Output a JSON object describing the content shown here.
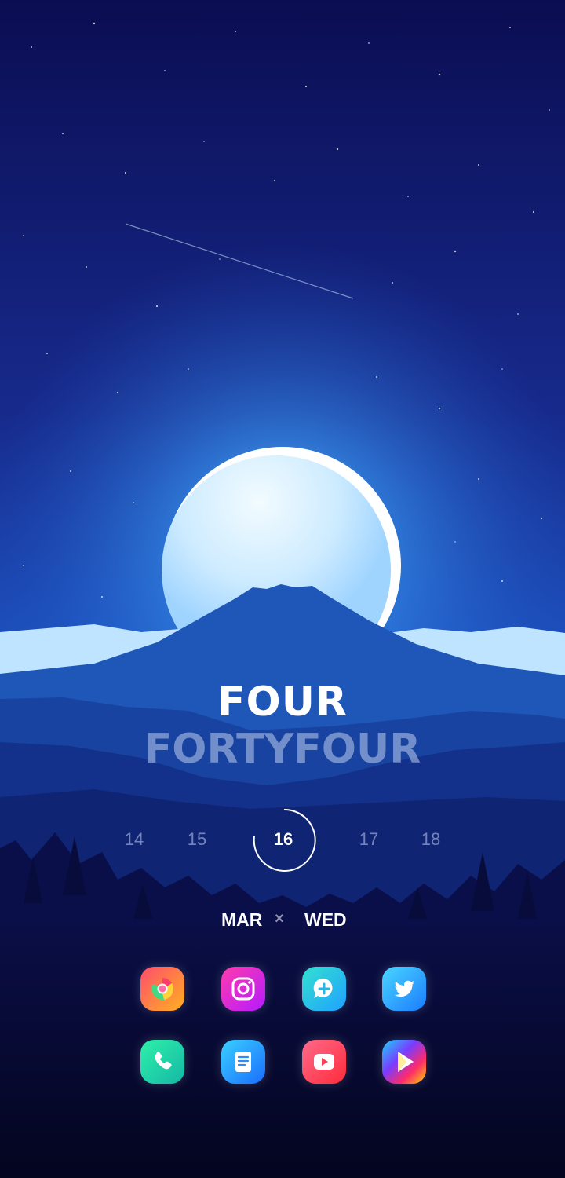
{
  "clock": {
    "hour_text": "FOUR",
    "minute_text": "FORTYFOUR"
  },
  "calendar": {
    "days": [
      "14",
      "15",
      "16",
      "17",
      "18"
    ],
    "current_day": "16",
    "month": "MAR",
    "separator": "×",
    "weekday": "WED"
  },
  "dock": {
    "row1": [
      {
        "icon": "chrome-icon",
        "colors": [
          "#ff4d6d",
          "#3ddc84",
          "#ffb020"
        ]
      },
      {
        "icon": "camera-icon",
        "colors": [
          "#ff3cac",
          "#b41aff"
        ]
      },
      {
        "icon": "chat-plus-icon",
        "colors": [
          "#34e0d0",
          "#1fa2ff"
        ]
      },
      {
        "icon": "twitter-icon",
        "colors": [
          "#4ad6ff",
          "#1b7cff"
        ]
      }
    ],
    "row2": [
      {
        "icon": "phone-icon",
        "colors": [
          "#2ff0a8",
          "#14b8a6"
        ]
      },
      {
        "icon": "document-icon",
        "colors": [
          "#3ad0ff",
          "#1a6dff"
        ]
      },
      {
        "icon": "youtube-icon",
        "colors": [
          "#ff5a7a",
          "#ff2b3a"
        ]
      },
      {
        "icon": "play-store-icon",
        "colors": [
          "#19d3ff",
          "#ffd400",
          "#ff2b6a"
        ]
      }
    ]
  },
  "colors": {
    "sky_top": "#0b0d52",
    "sky_glow": "#3ea6ff",
    "moon": "#dff3ff",
    "mountain": "#1f57b8",
    "forest": "#070a2e"
  }
}
